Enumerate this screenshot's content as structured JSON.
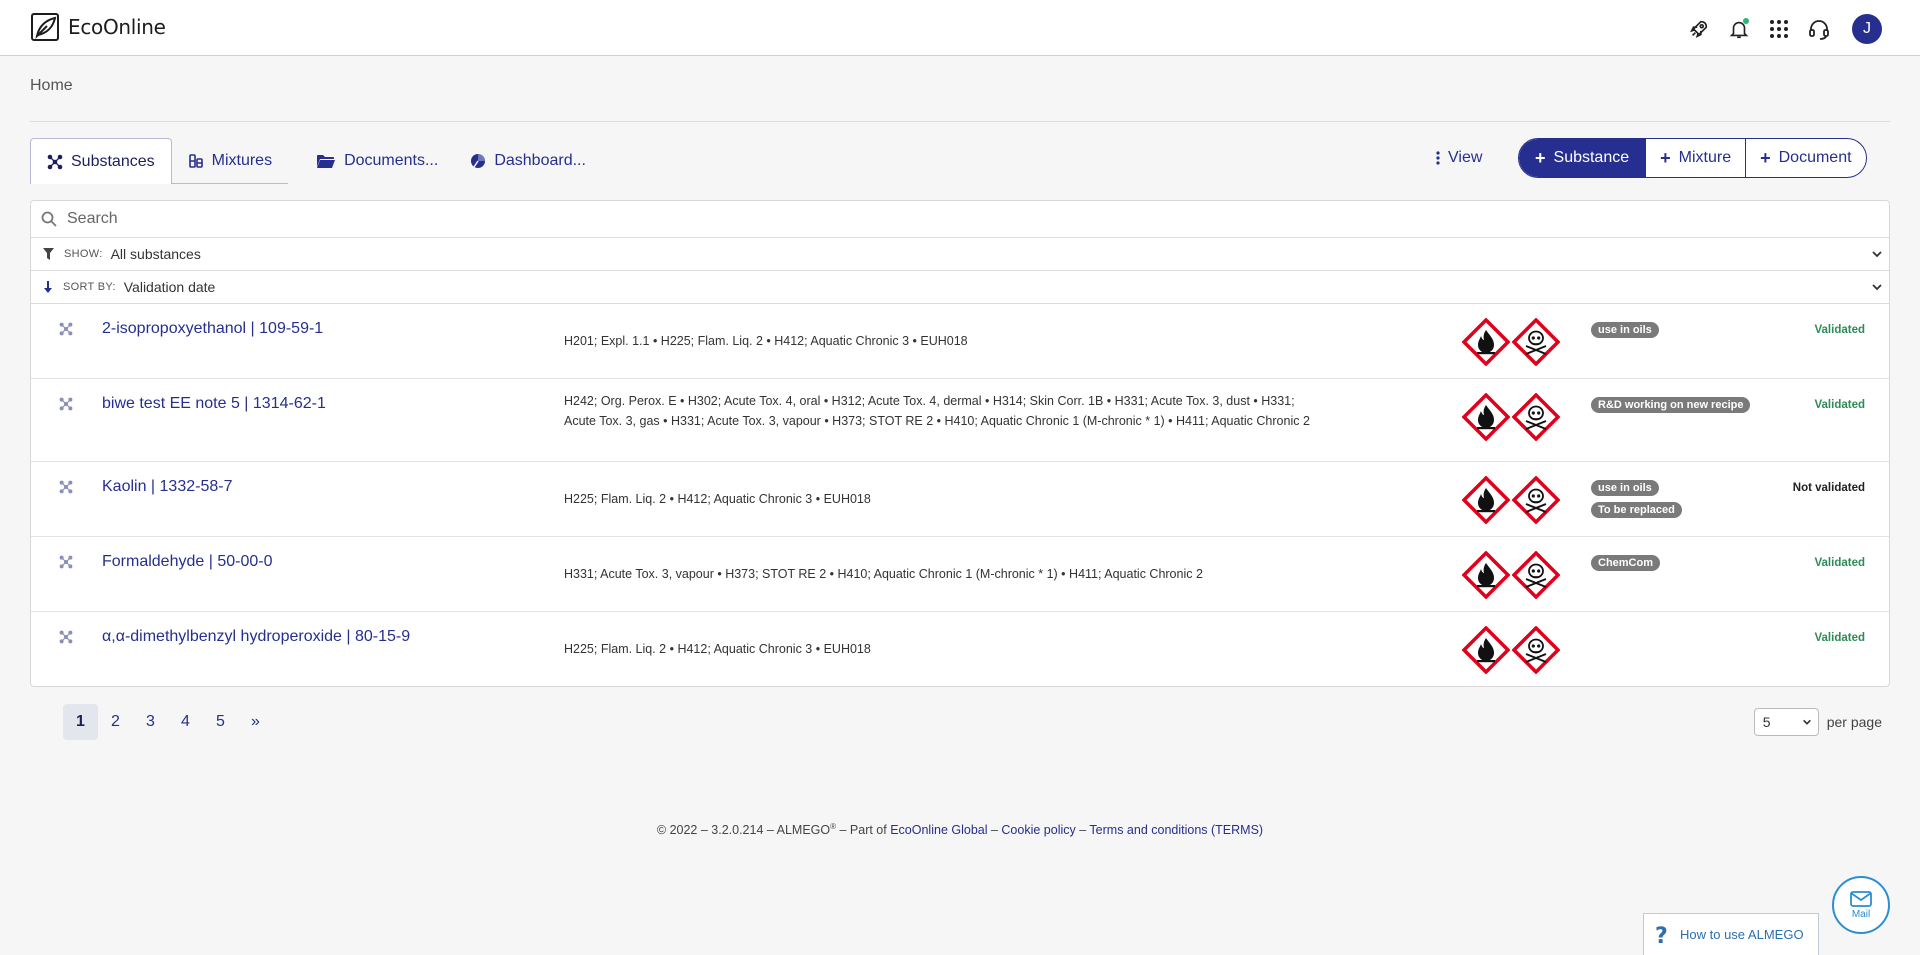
{
  "app": {
    "brand": "EcoOnline",
    "avatar_initial": "J"
  },
  "breadcrumb": "Home",
  "tabs": [
    {
      "label": "Substances",
      "icon": "substances-icon"
    },
    {
      "label": "Mixtures",
      "icon": "mixtures-icon"
    },
    {
      "label": "Documents...",
      "icon": "folder-icon"
    },
    {
      "label": "Dashboard...",
      "icon": "dashboard-icon"
    }
  ],
  "toolbar": {
    "view_label": "View",
    "add_substance": "Substance",
    "add_mixture": "Mixture",
    "add_document": "Document"
  },
  "search": {
    "placeholder": "Search"
  },
  "filter": {
    "key": "SHOW:",
    "value": "All substances"
  },
  "sort": {
    "key": "SORT BY:",
    "value": "Validation date"
  },
  "rows": [
    {
      "name": "2-isopropoxyethanol | 109-59-1",
      "hazard": "H201; Expl. 1.1 • H225; Flam. Liq. 2 • H412; Aquatic Chronic 3 • EUH018",
      "tags": [
        "use in oils"
      ],
      "status": "Validated"
    },
    {
      "name": "biwe test EE note 5 | 1314-62-1",
      "hazard": "H242; Org. Perox. E • H302; Acute Tox. 4, oral • H312; Acute Tox. 4, dermal • H314; Skin Corr. 1B • H331; Acute Tox. 3, dust • H331; Acute Tox. 3, gas • H331; Acute Tox. 3, vapour • H373; STOT RE 2 • H410; Aquatic Chronic 1 (M-chronic * 1) • H411; Aquatic Chronic 2",
      "tags": [
        "R&D working on new recipe"
      ],
      "status": "Validated"
    },
    {
      "name": "Kaolin | 1332-58-7",
      "hazard": "H225; Flam. Liq. 2 • H412; Aquatic Chronic 3 • EUH018",
      "tags": [
        "use in oils",
        "To be replaced"
      ],
      "status": "Not validated"
    },
    {
      "name": "Formaldehyde | 50-00-0",
      "hazard": "H331; Acute Tox. 3, vapour • H373; STOT RE 2 • H410; Aquatic Chronic 1 (M-chronic * 1) • H411; Aquatic Chronic 2",
      "tags": [
        "ChemCom"
      ],
      "status": "Validated"
    },
    {
      "name": "α,α-dimethylbenzyl hydroperoxide | 80-15-9",
      "hazard": "H225; Flam. Liq. 2 • H412; Aquatic Chronic 3 • EUH018",
      "tags": [],
      "status": "Validated"
    }
  ],
  "pagination": {
    "pages": [
      "1",
      "2",
      "3",
      "4",
      "5"
    ],
    "next": "»",
    "current": "1",
    "per_page_value": "5",
    "per_page_label": "per page"
  },
  "footer": {
    "prefix": "© 2022 – 3.2.0.214 – ALMEGO",
    "reg": "®",
    "part_of": " – Part of ",
    "global_link": "EcoOnline Global",
    "sep1": " – ",
    "cookie_link": "Cookie policy",
    "sep2": " – ",
    "terms_link": "Terms and conditions (TERMS)"
  },
  "help": {
    "mail_label": "Mail",
    "how_to": "How to use ALMEGO"
  },
  "colors": {
    "primary": "#262f8f",
    "validated": "#2e8b57",
    "tag": "#7a7a7a"
  }
}
